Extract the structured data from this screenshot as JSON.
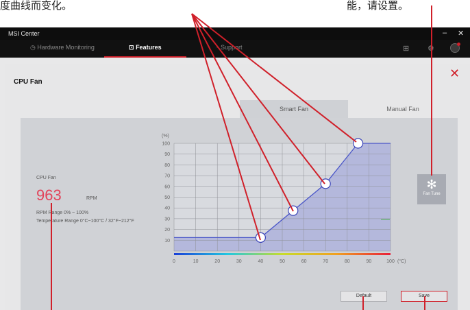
{
  "captions": {
    "left": "度曲线而变化。",
    "right": "能，请设置。"
  },
  "window": {
    "title": "MSI Center",
    "minimize": "–",
    "close": "✕"
  },
  "nav": {
    "tabs": [
      {
        "label": "Hardware Monitoring"
      },
      {
        "label": "Features"
      },
      {
        "label": "Support"
      }
    ]
  },
  "panel": {
    "title": "CPU Fan",
    "tabs": [
      {
        "label": "Smart Fan"
      },
      {
        "label": "Manual Fan"
      }
    ]
  },
  "fan_info": {
    "name": "CPU Fan",
    "rpm": "963",
    "rpm_unit": "RPM",
    "rpm_range": "RPM Range 0% ~ 100%",
    "temp_range": "Temperature Range 0°C~100°C / 32°F~212°F"
  },
  "buttons": {
    "fan_tune": "Fan Tune",
    "default": "Default",
    "save": "Save"
  },
  "chart_data": {
    "type": "line",
    "ylabel": "(%)",
    "xlabel": "(°C)",
    "x_ticks": [
      0,
      10,
      20,
      30,
      40,
      50,
      60,
      70,
      80,
      90,
      100
    ],
    "y_ticks": [
      10,
      20,
      30,
      40,
      50,
      60,
      70,
      80,
      90,
      100
    ],
    "xlim": [
      0,
      100
    ],
    "ylim": [
      0,
      100
    ],
    "grid": true,
    "series": [
      {
        "points": [
          [
            0,
            12.5
          ],
          [
            40,
            12.5
          ],
          [
            55,
            37.5
          ],
          [
            70,
            62.5
          ],
          [
            85,
            100
          ],
          [
            100,
            100
          ]
        ],
        "handles": [
          [
            40,
            12.5
          ],
          [
            55,
            37.5
          ],
          [
            70,
            62.5
          ],
          [
            85,
            100
          ]
        ]
      }
    ],
    "colors": {
      "line": "#4a56c8",
      "fill": "#aeb2dc",
      "grid": "#8e9096",
      "handle_stroke": "#3a44b8"
    }
  },
  "colors": {
    "accent": "#d0202a",
    "rpm": "#e2435a",
    "callout": "#d0202a"
  }
}
